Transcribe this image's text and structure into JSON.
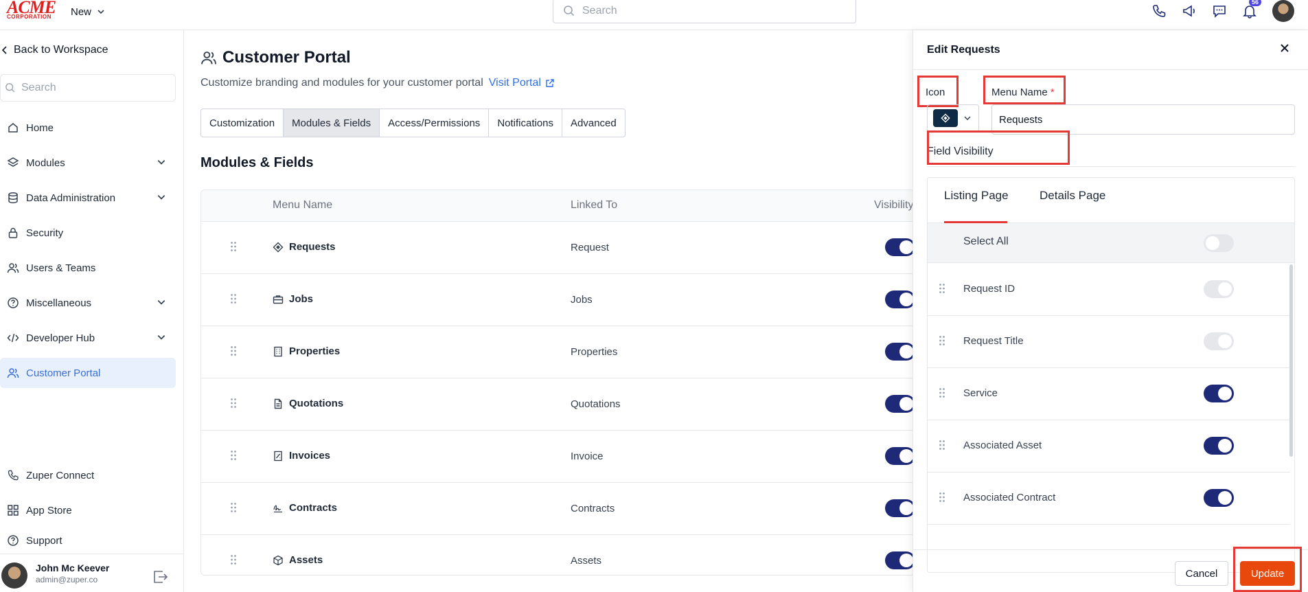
{
  "topbar": {
    "logo_main": "ACME",
    "logo_sub": "CORPORATION",
    "new_label": "New",
    "search_placeholder": "Search",
    "notification_count": "56",
    "icons": [
      "phone-icon",
      "megaphone-icon",
      "chat-icon",
      "bell-icon"
    ]
  },
  "sidebar": {
    "back_label": "Back to Workspace",
    "search_placeholder": "Search",
    "items": [
      {
        "label": "Home",
        "icon": "home-icon",
        "has_chevron": false
      },
      {
        "label": "Modules",
        "icon": "layers-icon",
        "has_chevron": true
      },
      {
        "label": "Data Administration",
        "icon": "database-icon",
        "has_chevron": true
      },
      {
        "label": "Security",
        "icon": "lock-icon",
        "has_chevron": false
      },
      {
        "label": "Users & Teams",
        "icon": "users-icon",
        "has_chevron": false
      },
      {
        "label": "Miscellaneous",
        "icon": "help-circle-icon",
        "has_chevron": true
      },
      {
        "label": "Developer Hub",
        "icon": "code-icon",
        "has_chevron": true
      },
      {
        "label": "Customer Portal",
        "icon": "users-icon",
        "has_chevron": false,
        "active": true
      }
    ],
    "bottom_items": [
      {
        "label": "Zuper Connect",
        "icon": "phone-icon"
      },
      {
        "label": "App Store",
        "icon": "app-grid-icon"
      },
      {
        "label": "Support",
        "icon": "help-circle-icon"
      }
    ],
    "user": {
      "name": "John Mc Keever",
      "email": "admin@zuper.co"
    }
  },
  "main": {
    "title": "Customer Portal",
    "subtitle": "Customize branding and modules for your customer portal",
    "visit_link": "Visit Portal",
    "tabs": [
      {
        "label": "Customization",
        "active": false
      },
      {
        "label": "Modules & Fields",
        "active": true
      },
      {
        "label": "Access/Permissions",
        "active": false
      },
      {
        "label": "Notifications",
        "active": false
      },
      {
        "label": "Advanced",
        "active": false
      }
    ],
    "section_title": "Modules & Fields",
    "table": {
      "headers": {
        "menu_name": "Menu Name",
        "linked_to": "Linked To",
        "visibility": "Visibility"
      },
      "rows": [
        {
          "name": "Requests",
          "linked": "Request",
          "icon": "diamond-icon",
          "visible": true
        },
        {
          "name": "Jobs",
          "linked": "Jobs",
          "icon": "briefcase-icon",
          "visible": true
        },
        {
          "name": "Properties",
          "linked": "Properties",
          "icon": "building-icon",
          "visible": true
        },
        {
          "name": "Quotations",
          "linked": "Quotations",
          "icon": "document-icon",
          "visible": true
        },
        {
          "name": "Invoices",
          "linked": "Invoice",
          "icon": "invoice-icon",
          "visible": true
        },
        {
          "name": "Contracts",
          "linked": "Contracts",
          "icon": "signature-icon",
          "visible": true
        },
        {
          "name": "Assets",
          "linked": "Assets",
          "icon": "cube-icon",
          "visible": true
        }
      ]
    }
  },
  "panel": {
    "title": "Edit Requests",
    "icon_label": "Icon",
    "menu_name_label": "Menu Name",
    "required_mark": "*",
    "menu_name_value": "Requests",
    "field_visibility_title": "Field Visibility",
    "tabs": {
      "listing": "Listing Page",
      "details": "Details Page",
      "active": "listing"
    },
    "select_all_label": "Select All",
    "fields": [
      {
        "name": "Request ID",
        "state": "disabled"
      },
      {
        "name": "Request Title",
        "state": "disabled"
      },
      {
        "name": "Service",
        "state": "on"
      },
      {
        "name": "Associated Asset",
        "state": "on"
      },
      {
        "name": "Associated Contract",
        "state": "on"
      }
    ],
    "cancel_label": "Cancel",
    "update_label": "Update",
    "colors": {
      "highlight": "#e53935",
      "primary": "#e8480c",
      "toggle_on": "#1e2a78"
    }
  }
}
